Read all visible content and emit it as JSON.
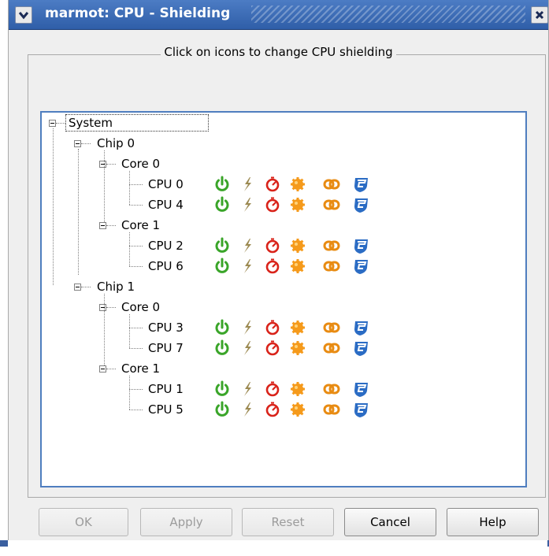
{
  "window": {
    "title": "marmot: CPU - Shielding",
    "menu_icon": "chevron-down-icon",
    "close_icon": "close-icon"
  },
  "group": {
    "title": "Click on icons to change CPU shielding"
  },
  "tree": {
    "root": "System",
    "chips": [
      {
        "label": "Chip 0",
        "cores": [
          {
            "label": "Core 0",
            "cpus": [
              "CPU 0",
              "CPU 4"
            ]
          },
          {
            "label": "Core 1",
            "cpus": [
              "CPU 2",
              "CPU 6"
            ]
          }
        ]
      },
      {
        "label": "Chip 1",
        "cores": [
          {
            "label": "Core 0",
            "cpus": [
              "CPU 3",
              "CPU 7"
            ]
          },
          {
            "label": "Core 1",
            "cpus": [
              "CPU 1",
              "CPU 5"
            ]
          }
        ]
      }
    ],
    "cpu_icons": [
      "power-icon",
      "lightning-icon",
      "timer-icon",
      "gear-icon",
      "link-icon",
      "shield-icon"
    ]
  },
  "buttons": {
    "ok": "OK",
    "apply": "Apply",
    "reset": "Reset",
    "cancel": "Cancel",
    "help": "Help"
  },
  "colors": {
    "titlebar": "#3565b0",
    "tree_border": "#4f7ebf",
    "power": "#3aa529",
    "lightning": "#9c8a52",
    "timer": "#d9231a",
    "gear": "#f59a1b",
    "link": "#e88b12",
    "shield": "#2b6cc4"
  }
}
